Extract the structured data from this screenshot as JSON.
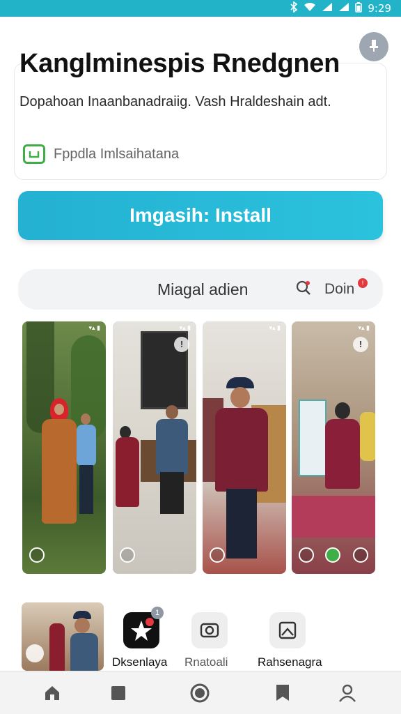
{
  "status_bar": {
    "time": "9:29",
    "icons": [
      "bluetooth-icon",
      "wifi-icon",
      "signal-icon",
      "signal-icon",
      "battery-icon"
    ]
  },
  "app": {
    "title": "Kanglminespis Rnedgnen",
    "description": "Dopahoan Inaanbanadraiig. Vash Hraldeshain adt.",
    "verified_text": "Fppdla Imlsaihatana"
  },
  "install_button": {
    "label": "Imgasih: Install"
  },
  "search_bar": {
    "label": "Miagal adien",
    "lang_label": "Doin",
    "badge": "!"
  },
  "screenshots": [
    {
      "status": "▾▴ ▮"
    },
    {
      "status": "▾▴ ▮",
      "info": "!"
    },
    {
      "status": "▾▴ ▮"
    },
    {
      "status": "▾▴ ▮",
      "info": "!"
    }
  ],
  "apps": [
    {
      "label": "Dksenlaya",
      "badge": "1"
    },
    {
      "label": "Rnatoali"
    },
    {
      "label": "Rahsenagra"
    }
  ],
  "nav": [
    "home-icon",
    "library-icon",
    "record-icon",
    "bookmark-icon",
    "profile-icon"
  ],
  "colors": {
    "accent": "#22b3c9",
    "verified": "#3fae47",
    "badge": "#e33a3f"
  }
}
